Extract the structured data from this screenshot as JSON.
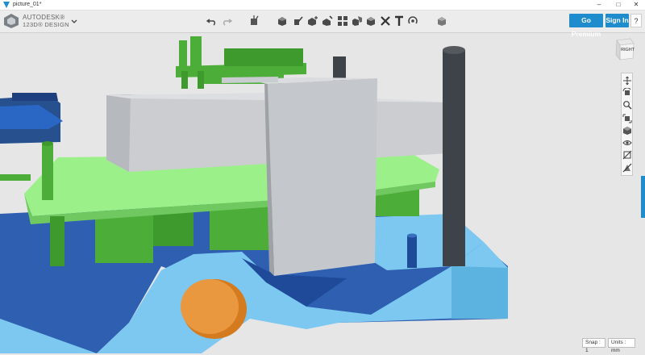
{
  "window": {
    "title": "picture_01*",
    "controls": [
      "minimize-icon",
      "maximize-icon",
      "close-icon"
    ]
  },
  "brand": {
    "line1": "AUTODESK®",
    "line2": "123D® DESIGN"
  },
  "toolbar": {
    "tools": [
      "undo-icon",
      "redo-icon",
      "transform-icon",
      "primitives-icon",
      "sketch-icon",
      "construct-icon",
      "modify-icon",
      "pattern-icon",
      "grouping-icon",
      "combine-icon",
      "measure-icon",
      "text-icon",
      "snap-icon",
      "material-icon"
    ],
    "go_premium": "Go Premium",
    "sign_in": "Sign In",
    "help": "?"
  },
  "viewcube": {
    "face": "RIGHT"
  },
  "navbar": {
    "tools": [
      "pan-icon",
      "orbit-icon",
      "zoom-icon",
      "fit-icon",
      "views-icon",
      "visibility-icon",
      "hide-icon",
      "hide-mesh-icon"
    ]
  },
  "status": {
    "snap": "Snap : 1",
    "units": "Units : mm"
  },
  "colors": {
    "accent": "#1e8ccd",
    "green": "#4cae38",
    "light_green": "#9cf089",
    "grey_block": "#c4c7cb",
    "dark_post": "#3d4348",
    "blue_base": "#2e5fb0",
    "light_blue": "#7cc8f0",
    "orange": "#e08a2e"
  }
}
